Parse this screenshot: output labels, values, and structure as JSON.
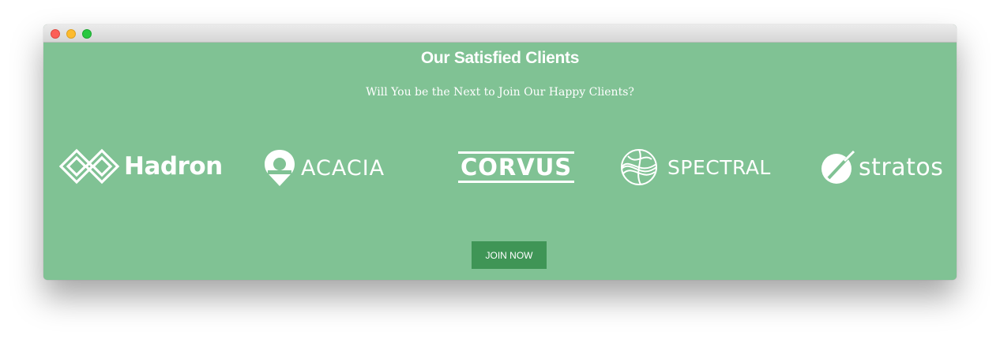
{
  "window": {
    "controls": [
      "close",
      "minimize",
      "maximize"
    ]
  },
  "section": {
    "heading": "Our Satisfied Clients",
    "subheading": "Will You be the Next to Join Our Happy Clients?"
  },
  "clients": [
    {
      "name": "Hadron",
      "icon": "hadron-diamond-logo-icon"
    },
    {
      "name": "ACACIA",
      "icon": "acacia-pin-logo-icon"
    },
    {
      "name": "CORVUS",
      "icon": ""
    },
    {
      "name": "SPECTRAL",
      "icon": "spectral-sphere-logo-icon"
    },
    {
      "name": "stratos",
      "icon": "stratos-circle-logo-icon"
    }
  ],
  "cta": {
    "join_label": "JOIN NOW"
  },
  "colors": {
    "background": "#80c294",
    "button": "#3f9556",
    "text": "#ffffff"
  }
}
